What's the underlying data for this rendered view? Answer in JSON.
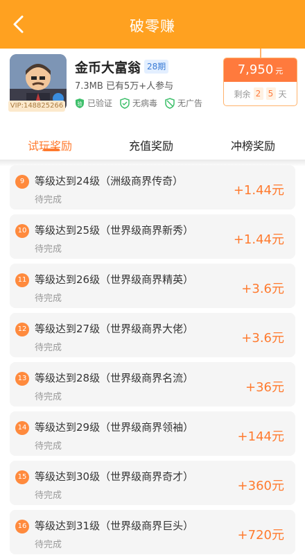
{
  "header": {
    "title": "破零赚"
  },
  "app": {
    "name": "金币大富翁",
    "period": "28期",
    "meta": "7.3MB 已有5万+人参与",
    "vip": "VIP:148825266",
    "checks": [
      "已验证",
      "无病毒",
      "无广告"
    ]
  },
  "price": {
    "amount": "7,950",
    "unit": "元",
    "remain_label": "剩余",
    "days": [
      "2",
      "5"
    ],
    "day_unit": "天"
  },
  "tabs": [
    "试玩奖励",
    "充值奖励",
    "冲榜奖励"
  ],
  "tasks": [
    {
      "num": "9",
      "title": "等级达到24级（洲级商界传奇）",
      "status": "待完成",
      "reward": "+1.44元"
    },
    {
      "num": "10",
      "title": "等级达到25级（世界级商界新秀）",
      "status": "待完成",
      "reward": "+1.44元"
    },
    {
      "num": "11",
      "title": "等级达到26级（世界级商界精英）",
      "status": "待完成",
      "reward": "+3.6元"
    },
    {
      "num": "12",
      "title": "等级达到27级（世界级商界大佬）",
      "status": "待完成",
      "reward": "+3.6元"
    },
    {
      "num": "13",
      "title": "等级达到28级（世界级商界名流）",
      "status": "待完成",
      "reward": "+36元"
    },
    {
      "num": "14",
      "title": "等级达到29级（世界级商界领袖）",
      "status": "待完成",
      "reward": "+144元"
    },
    {
      "num": "15",
      "title": "等级达到30级（世界级商界奇才）",
      "status": "待完成",
      "reward": "+360元"
    },
    {
      "num": "16",
      "title": "等级达到31级（世界级商界巨头）",
      "status": "待完成",
      "reward": "+720元"
    }
  ],
  "colors": {
    "header": "#ffa120",
    "accent": "#ff7a2e"
  }
}
